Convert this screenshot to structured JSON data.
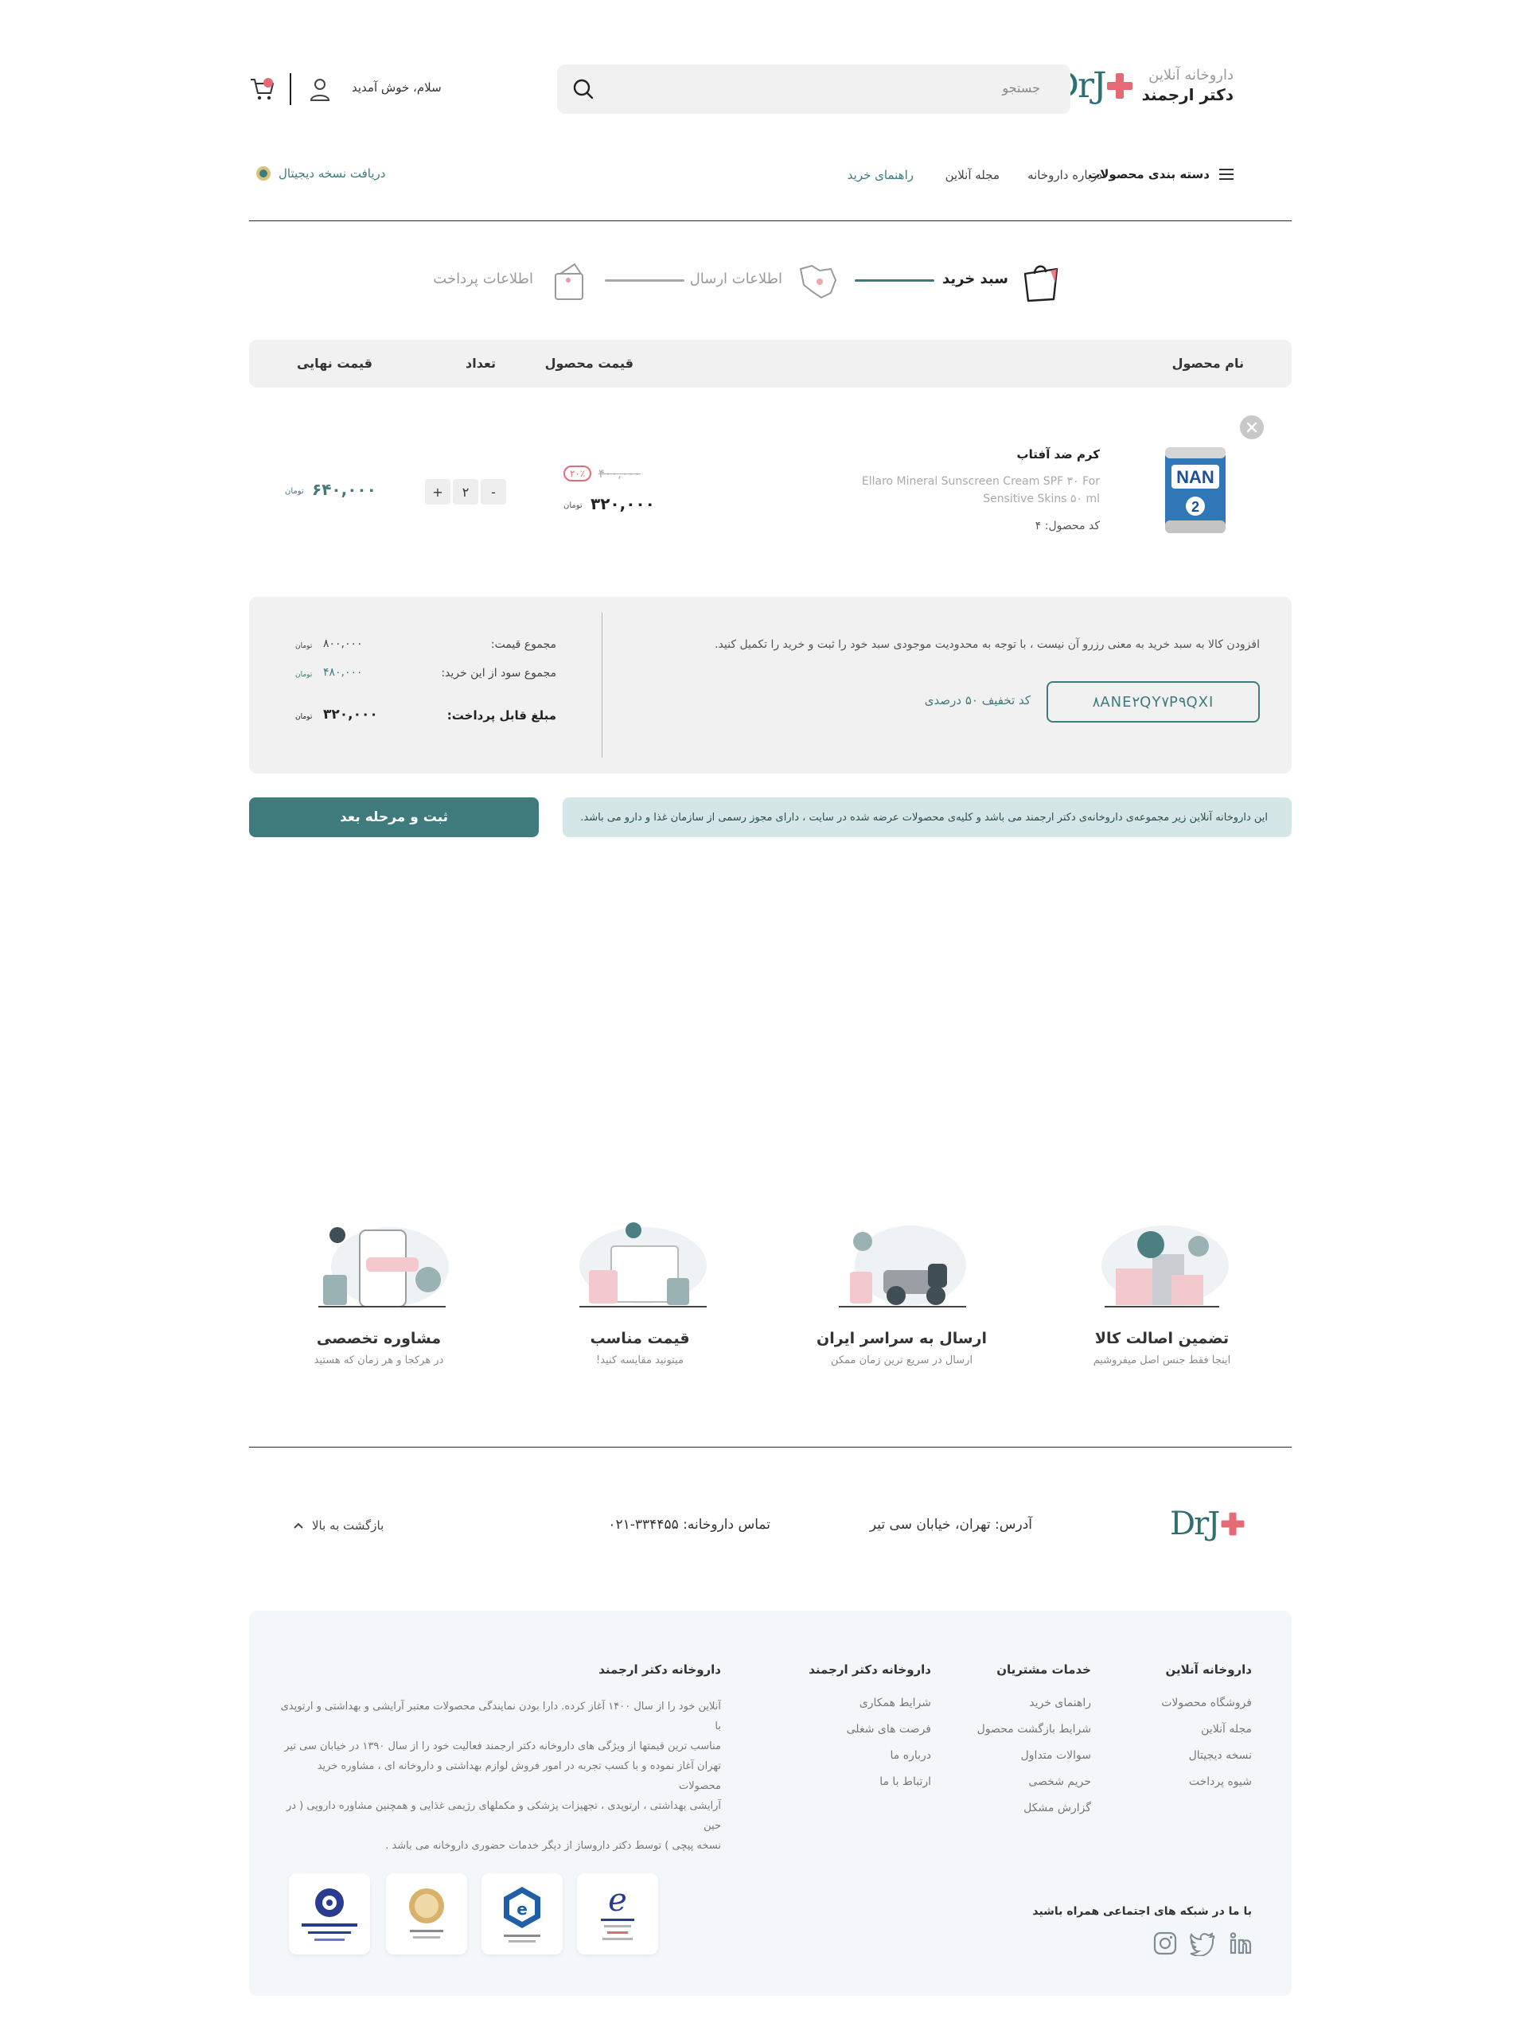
{
  "header": {
    "brand_small": "داروخانه آنلاین",
    "brand_big": "دکتر ارجمند",
    "logo_text": "DrJ",
    "search_placeholder": "جستجو",
    "greeting": "سلام، خوش آمدید"
  },
  "nav": {
    "categories": "دسته بندی محصولات",
    "items": [
      "درباره داروخانه",
      "مجله آنلاین",
      "راهنمای خرید"
    ],
    "digital": "دریافت نسخه دیجیتال"
  },
  "steps": [
    {
      "label": "سبد خرید",
      "active": true
    },
    {
      "label": "اطلاعات ارسال",
      "active": false
    },
    {
      "label": "اطلاعات پرداخت",
      "active": false
    }
  ],
  "table": {
    "headers": {
      "name": "نام محصول",
      "price": "قیمت محصول",
      "qty": "تعداد",
      "final": "قیمت نهایی"
    }
  },
  "item": {
    "title": "کرم ضد آفتاب",
    "desc_line1": "Ellaro Mineral Sunscreen Cream SPF ۳۰ For",
    "desc_line2": "Sensitive Skins ۵۰ ml",
    "code": "کد محصول: ۴",
    "old_price": "۴۰۰,۰۰۰",
    "discount": "۲۰٪",
    "price": "۳۲۰,۰۰۰",
    "currency": "تومان",
    "qty": "۲",
    "plus": "+",
    "minus": "-",
    "final": "۶۴۰,۰۰۰"
  },
  "summary": {
    "note": "افزودن کالا به سبد خرید به معنی رزرو آن نیست ، با توجه به محدودیت موجودی سبد خود را ثبت و خرید را تکمیل کنید.",
    "discount_code": "۸ANE۲QY۷P۹QXI",
    "discount_label": "کد تخفیف ۵۰ درصدی",
    "total_label": "مجموع قیمت:",
    "total": "۸۰۰,۰۰۰",
    "profit_label": "مجموع سود از این خرید:",
    "profit": "۴۸۰,۰۰۰",
    "payable_label": "مبلغ قابل پرداخت:",
    "payable": "۳۲۰,۰۰۰",
    "currency": "تومان"
  },
  "submit": "ثبت و مرحله بعد",
  "notice": "این داروخانه آنلاین زیر مجموعه‌ی داروخانه‌ی دکتر ارجمند می باشد و کلیه‌ی محصولات عرضه شده در سایت ، دارای مجوز رسمی از سازمان غذا و دارو می باشد.",
  "features": [
    {
      "title": "تضمین اصالت کالا",
      "sub": "اینجا فقط جنس اصل میفروشیم"
    },
    {
      "title": "ارسال به سراسر ایران",
      "sub": "ارسال در سریع ترین زمان ممکن"
    },
    {
      "title": "قیمت مناسب",
      "sub": "میتونید مقایسه کنید!"
    },
    {
      "title": "مشاوره تخصصی",
      "sub": "در هرکجا و هر زمان که هستید"
    }
  ],
  "footer_bar": {
    "address": "آدرس: تهران، خیابان سی تیر",
    "phone": "تماس داروخانه: ۳۳۴۴۵۵-۰۲۱",
    "back_top": "بازگشت به بالا"
  },
  "footer": {
    "columns": [
      {
        "title": "داروخانه آنلاین",
        "items": [
          "فروشگاه محصولات",
          "مجله آنلاین",
          "نسخه دیجیتال",
          "شیوه پرداخت"
        ]
      },
      {
        "title": "خدمات مشتریان",
        "items": [
          "راهنمای خرید",
          "شرایط بازگشت محصول",
          "سوالات متداول",
          "حریم شخصی",
          "گزارش مشکل"
        ]
      },
      {
        "title": "داروخانه دکتر ارجمند",
        "items": [
          "شرایط همکاری",
          "فرصت های شغلی",
          "درباره ما",
          "ارتباط با ما"
        ]
      }
    ],
    "about_title": "داروخانه دکتر ارجمند",
    "about_lines": [
      "آنلاین خود را از سال ۱۴۰۰ آغاز کرده. دارا بودن نمایندگی محصولات معتبر آرایشی و بهداشتی و ارتوپدی با",
      "مناسب ترین قیمتها از ویژگی های داروخانه دکتر ارجمند فعالیت خود را از سال ۱۳۹۰ در خیابان سی تیر",
      "تهران آغاز نموده و با کسب تجربه در امور فروش لوازم بهداشتی و داروخانه ای ، مشاوره خرید محصولات",
      "آرایشی بهداشتی ، ارتوپدی ، تجهیزات پزشکی و مکملهای رژیمی غذایی و همچنین مشاوره دارویی ( در حین",
      "نسخه پیچی ) توسط دکتر داروساز از دیگر خدمات حضوری داروخانه می باشد ."
    ],
    "social_title": "با ما در شبکه های اجتماعی همراه باشید"
  },
  "colors": {
    "accent": "#3f7a7c",
    "pink": "#e56a76",
    "panel": "#f1f1f1"
  }
}
